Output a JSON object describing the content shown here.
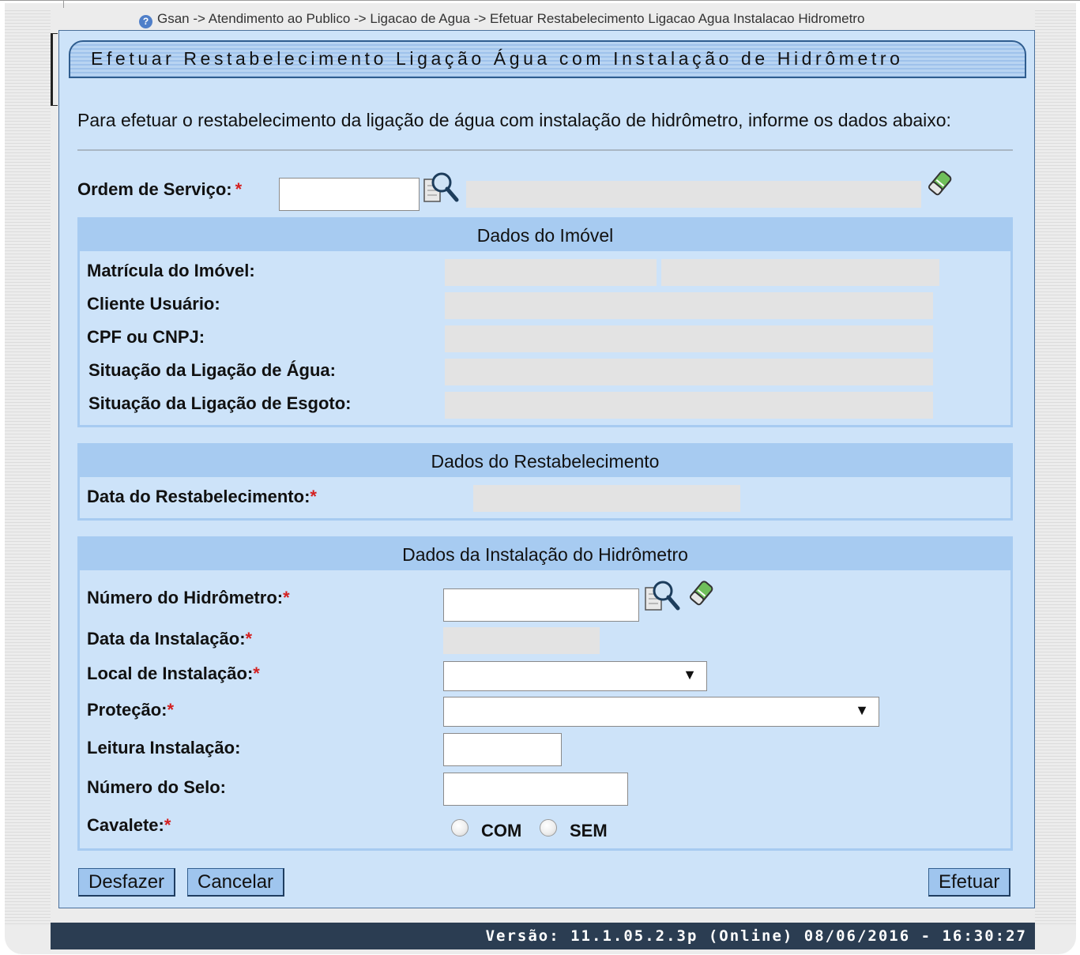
{
  "breadcrumb": "Gsan -> Atendimento ao Publico -> Ligacao de Agua -> Efetuar Restabelecimento Ligacao Agua Instalacao Hidrometro",
  "title": "Efetuar Restabelecimento Ligação Água com Instalação de Hidrômetro",
  "intro": "Para efetuar o restabelecimento da ligação de água com instalação de hidrômetro, informe os dados abaixo:",
  "ordem": {
    "label": "Ordem de Serviço:",
    "required": "*",
    "value": ""
  },
  "imovel": {
    "header": "Dados do Imóvel",
    "matricula": "Matrícula do Imóvel:",
    "cliente": "Cliente Usuário:",
    "cpf": "CPF ou CNPJ:",
    "sit_agua": "Situação da Ligação de Água:",
    "sit_esgoto": "Situação da Ligação de Esgoto:"
  },
  "restabelecimento": {
    "header": "Dados do Restabelecimento",
    "data_label": "Data do Restabelecimento:",
    "required": "*"
  },
  "hidrometro": {
    "header": "Dados da Instalação do Hidrômetro",
    "numero": "Número do Hidrômetro:",
    "data_instalacao": "Data da Instalação:",
    "local": "Local de Instalação:",
    "protecao": "Proteção:",
    "leitura": "Leitura Instalação:",
    "selo": "Número do Selo:",
    "cavalete": "Cavalete:",
    "required": "*",
    "com": "COM",
    "sem": "SEM",
    "select_arrow": "▼"
  },
  "buttons": {
    "desfazer": "Desfazer",
    "cancelar": "Cancelar",
    "efetuar": "Efetuar"
  },
  "footer": "Versão: 11.1.05.2.3p (Online) 08/06/2016 - 16:30:27",
  "help_icon_glyph": "?"
}
